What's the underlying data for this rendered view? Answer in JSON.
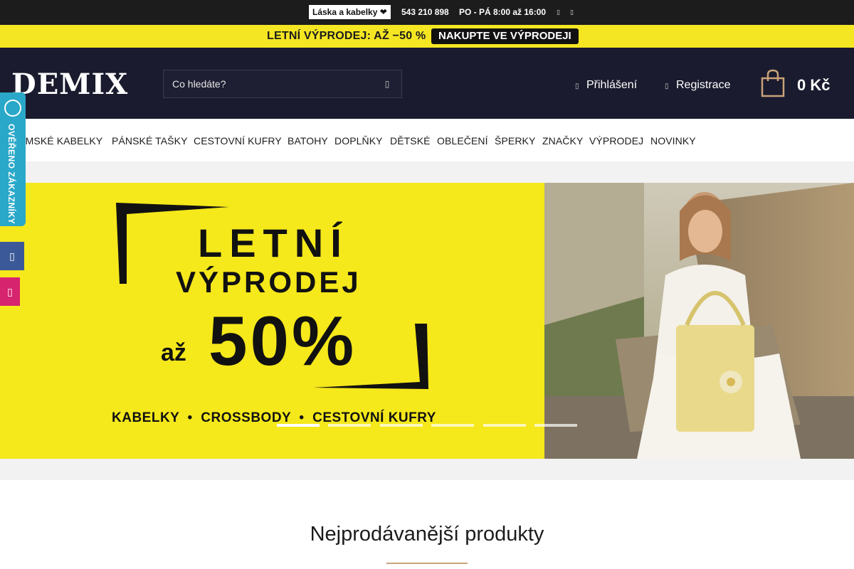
{
  "topbar": {
    "badge": "Láska a kabelky ❤",
    "phone": "543 210 898",
    "hours": "PO - PÁ 8:00 až 16:00",
    "icons": [
      "facebook-icon",
      "instagram-icon"
    ]
  },
  "promo": {
    "text": "LETNÍ VÝPRODEJ: AŽ −50 %",
    "cta": "NAKUPTE VE VÝPRODEJI"
  },
  "header": {
    "logo": "DEMIX",
    "search_placeholder": "Co hledáte?",
    "login": "Přihlášení",
    "register": "Registrace",
    "cart_total": "0 Kč"
  },
  "nav": {
    "items": [
      "DÁMSKÉ KABELKY",
      "PÁNSKÉ TAŠKY",
      "CESTOVNÍ KUFRY",
      "BATOHY",
      "DOPLŇKY",
      "DĚTSKÉ",
      "OBLEČENÍ",
      "ŠPERKY",
      "ZNAČKY",
      "VÝPRODEJ",
      "NOVINKY"
    ]
  },
  "hero": {
    "line1": "LETNÍ",
    "line2": "VÝPRODEJ",
    "prefix": "až",
    "percent": "50%",
    "categories": "KABELKY  •  CROSSBODY  •  CESTOVNÍ KUFRY",
    "slides_total": 6,
    "active_slide": 1
  },
  "sidebar": {
    "verified": "OVĚŘENO ZÁKAZNÍKY"
  },
  "section": {
    "title": "Nejprodávanější produkty"
  },
  "colors": {
    "topbar": "#1c1c1c",
    "promo": "#f5e623",
    "header": "#1a1b2e",
    "hero_yellow": "#f5e81b",
    "verified": "#29a8c9",
    "accent_line": "#c9a27a"
  }
}
